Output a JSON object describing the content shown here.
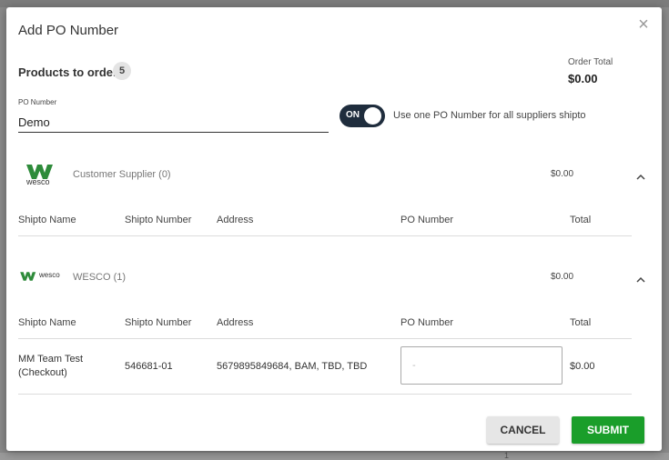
{
  "modal": {
    "title": "Add PO Number",
    "close_glyph": "×"
  },
  "summary": {
    "products_label": "Products to order",
    "products_count": "5",
    "order_total_label": "Order Total",
    "order_total_value": "$0.00"
  },
  "po_field": {
    "label": "PO Number",
    "value": "Demo"
  },
  "toggle": {
    "state_label": "ON",
    "checked": true,
    "description": "Use one PO Number for all suppliers shipto"
  },
  "suppliers": [
    {
      "logo_text": "wesco",
      "logo_icon": "wesco-logo-icon",
      "name": "Customer Supplier (0)",
      "total": "$0.00",
      "expanded": true,
      "columns": [
        "Shipto Name",
        "Shipto Number",
        "Address",
        "PO Number",
        "Total"
      ],
      "rows": []
    },
    {
      "logo_text": "wesco",
      "logo_icon": "wesco-logo-icon",
      "name": "WESCO (1)",
      "total": "$0.00",
      "expanded": true,
      "columns": [
        "Shipto Name",
        "Shipto Number",
        "Address",
        "PO Number",
        "Total"
      ],
      "rows": [
        {
          "shipto_name_line1": "MM Team Test",
          "shipto_name_line2": "(Checkout)",
          "shipto_number": "546681-01",
          "address": "5679895849684, BAM, TBD, TBD",
          "po_placeholder": "-",
          "total": "$0.00"
        }
      ]
    }
  ],
  "footer": {
    "cancel_label": "CANCEL",
    "submit_label": "SUBMIT"
  },
  "colors": {
    "brand_green": "#1a9e2a",
    "toggle_dark": "#1f2d3d",
    "wesco_green": "#2e8b3a"
  },
  "backdrop": {
    "page_fragment": "1"
  }
}
